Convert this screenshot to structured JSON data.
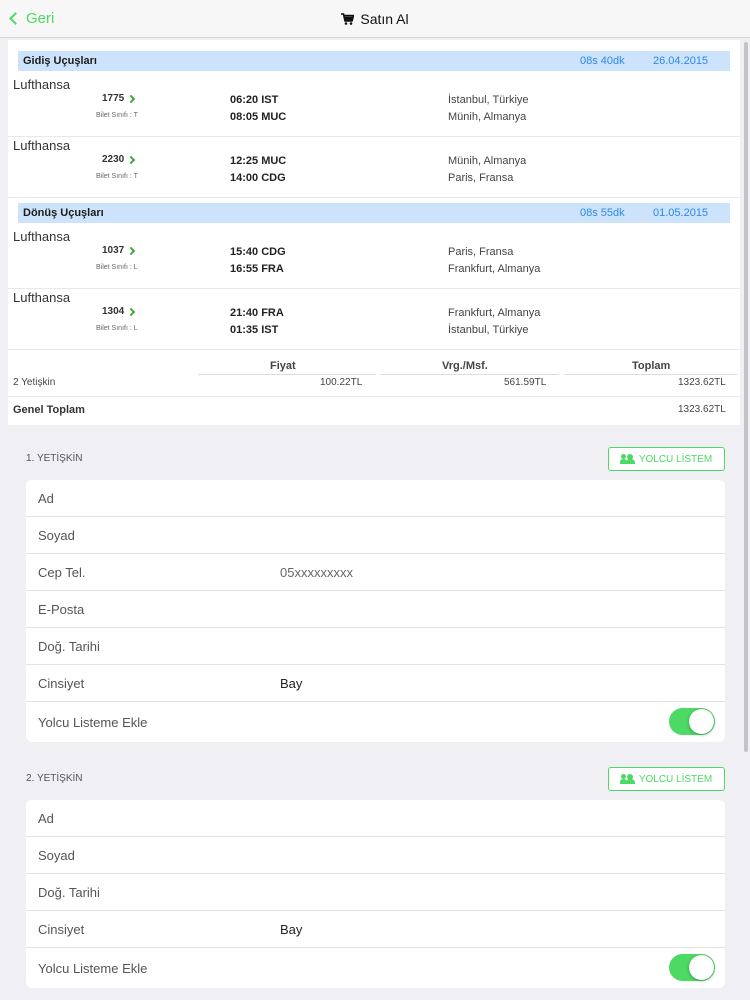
{
  "navbar": {
    "back_label": "Geri",
    "title": "Satın Al"
  },
  "outbound": {
    "title": "Gidiş Uçuşları",
    "duration": "08s 40dk",
    "date": "26.04.2015",
    "flights": [
      {
        "airline": "Lufthansa",
        "flight_no": "1775",
        "class": "Bilet Sınıfı : T",
        "dep": "06:20  IST",
        "arr": "08:05  MUC",
        "dep_city": "İstanbul, Türkiye",
        "arr_city": "Münih, Almanya"
      },
      {
        "airline": "Lufthansa",
        "flight_no": "2230",
        "class": "Bilet Sınıfı : T",
        "dep": "12:25  MUC",
        "arr": "14:00  CDG",
        "dep_city": "Münih, Almanya",
        "arr_city": "Paris, Fransa"
      }
    ]
  },
  "return": {
    "title": "Dönüş Uçuşları",
    "duration": "08s 55dk",
    "date": "01.05.2015",
    "flights": [
      {
        "airline": "Lufthansa",
        "flight_no": "1037",
        "class": "Bilet Sınıfı : L",
        "dep": "15:40  CDG",
        "arr": "16:55  FRA",
        "dep_city": "Paris, Fransa",
        "arr_city": "Frankfurt, Almanya"
      },
      {
        "airline": "Lufthansa",
        "flight_no": "1304",
        "class": "Bilet Sınıfı : L",
        "dep": "21:40  FRA",
        "arr": "01:35  IST",
        "dep_city": "Frankfurt, Almanya",
        "arr_city": "İstanbul, Türkiye"
      }
    ]
  },
  "pricing": {
    "headers": [
      "Fiyat",
      "Vrg./Msf.",
      "Toplam"
    ],
    "row_label": "2 Yetişkin",
    "price": "100.22TL",
    "tax": "561.59TL",
    "total": "1323.62TL",
    "grand_label": "Genel Toplam",
    "grand_total": "1323.62TL"
  },
  "passengers": [
    {
      "label": "1. YETİŞKİN",
      "list_button": "YOLCU LİSTEM",
      "fields": [
        {
          "label": "Ad",
          "value": ""
        },
        {
          "label": "Soyad",
          "value": ""
        },
        {
          "label": "Cep Tel.",
          "value": "05xxxxxxxxx"
        },
        {
          "label": "E-Posta",
          "value": ""
        },
        {
          "label": "Doğ. Tarihi",
          "value": ""
        },
        {
          "label": "Cinsiyet",
          "value": "Bay"
        }
      ],
      "toggle_label": "Yolcu Listeme Ekle",
      "toggle_on": true
    },
    {
      "label": "2. YETİŞKİN",
      "list_button": "YOLCU LİSTEM",
      "fields": [
        {
          "label": "Ad",
          "value": ""
        },
        {
          "label": "Soyad",
          "value": ""
        },
        {
          "label": "Doğ. Tarihi",
          "value": ""
        },
        {
          "label": "Cinsiyet",
          "value": "Bay"
        }
      ],
      "toggle_label": "Yolcu Listeme Ekle",
      "toggle_on": true
    }
  ],
  "colors": {
    "accent": "#4cd964",
    "section_bg": "#cce3fb",
    "section_date": "#2e88e8"
  },
  "icons": [
    "chevron-left-icon",
    "cart-icon",
    "chevron-right-icon",
    "people-icon"
  ]
}
